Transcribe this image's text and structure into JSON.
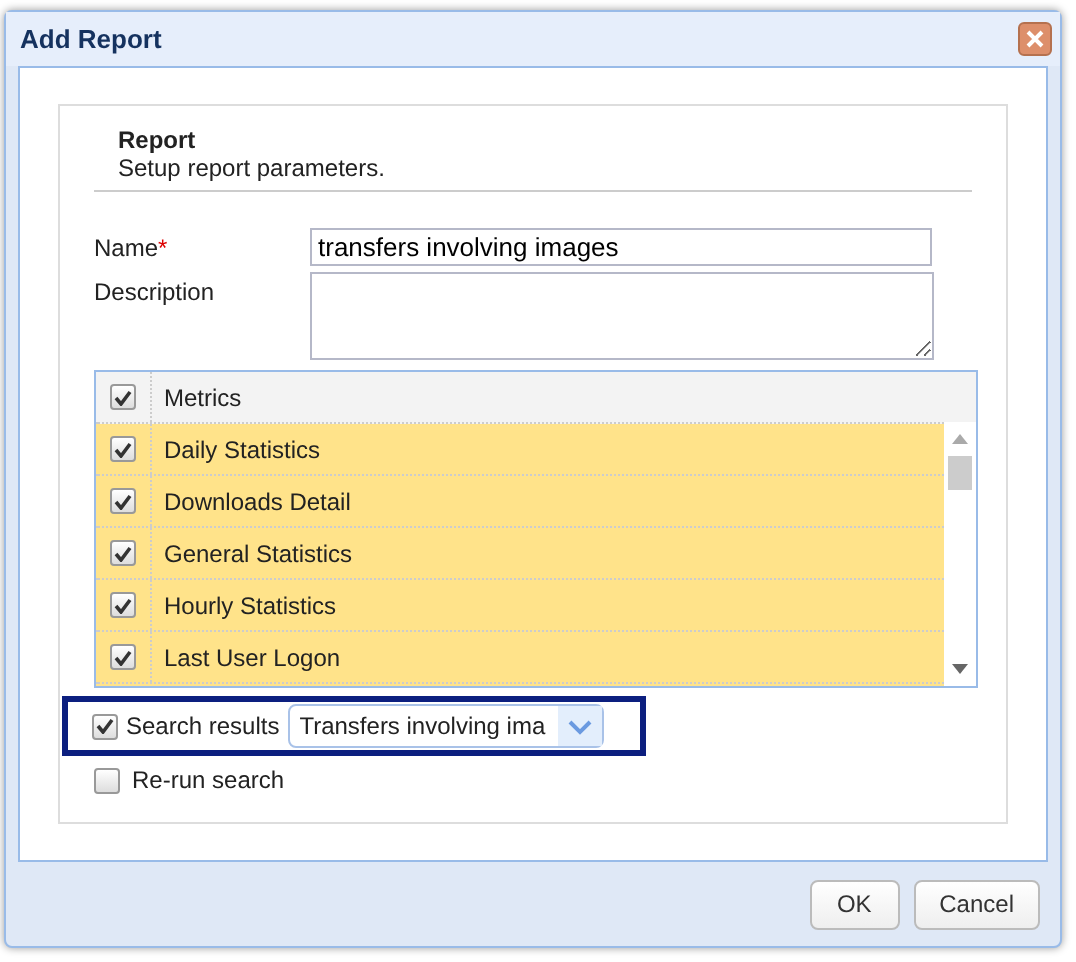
{
  "window": {
    "title": "Add Report"
  },
  "section": {
    "title": "Report",
    "subtitle": "Setup report parameters."
  },
  "fields": [
    {
      "label": "Name",
      "required_mark": "*",
      "value": "transfers involving images",
      "kind": "input"
    },
    {
      "label": "Description",
      "kind": "textarea"
    }
  ],
  "metrics": {
    "header": {
      "label": "Metrics",
      "checked": true
    },
    "rows": [
      {
        "label": "Daily Statistics",
        "checked": true,
        "selected": true
      },
      {
        "label": "Downloads Detail",
        "checked": true,
        "selected": true
      },
      {
        "label": "General Statistics",
        "checked": true,
        "selected": true
      },
      {
        "label": "Hourly Statistics",
        "checked": true,
        "selected": true
      },
      {
        "label": "Last User Logon",
        "checked": true,
        "selected": true
      }
    ]
  },
  "search_results": {
    "label": "Search results",
    "checked": true,
    "value": "Transfers involving ima"
  },
  "rerun": {
    "label": "Re-run search",
    "checked": false
  },
  "buttons": [
    "OK",
    "Cancel"
  ]
}
